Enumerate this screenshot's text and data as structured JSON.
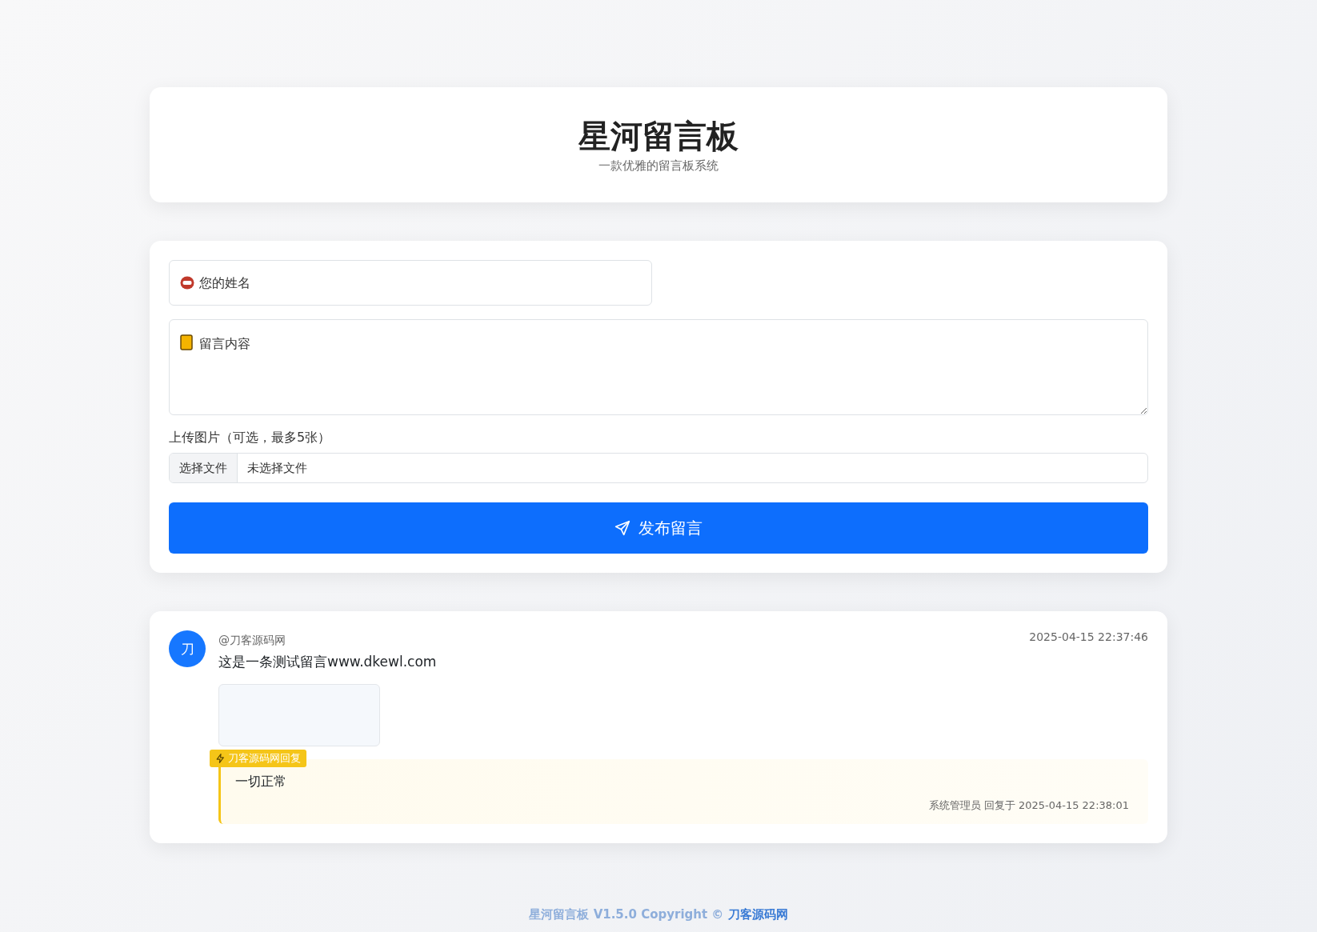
{
  "header": {
    "title": "星河留言板",
    "subtitle": "一款优雅的留言板系统"
  },
  "form": {
    "name_field": {
      "placeholder": "您的姓名"
    },
    "content_field": {
      "placeholder": "留言内容"
    },
    "upload_label": "上传图片（可选，最多5张）",
    "file_button": "选择文件",
    "file_status": "未选择文件",
    "submit": "发布留言"
  },
  "messages": [
    {
      "avatar": "刀",
      "author": "@刀客源码网",
      "time": "2025-04-15 22:37:46",
      "text": "这是一条测试留言www.dkewl.com",
      "has_image": true,
      "reply": {
        "badge": "刀客源码网回复",
        "text": "一切正常",
        "meta": "系统管理员 回复于 2025-04-15 22:38:01"
      }
    }
  ],
  "footer": {
    "text": "星河留言板 V1.5.0 Copyright ©",
    "link": "刀客源码网"
  }
}
